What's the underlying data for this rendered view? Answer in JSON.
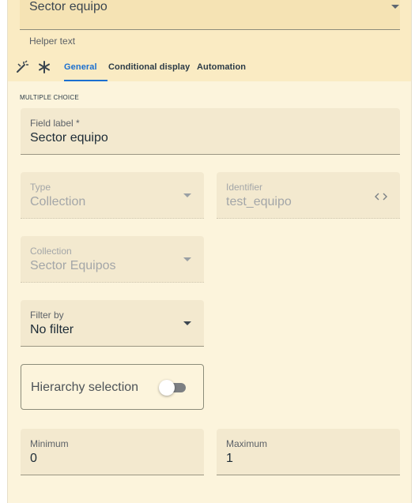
{
  "top_field": {
    "value": "Sector equipo",
    "helper": "Helper text"
  },
  "toolbar": {
    "tabs": [
      {
        "label": "General",
        "active": true
      },
      {
        "label": "Conditional display",
        "active": false
      },
      {
        "label": "Automation",
        "active": false
      }
    ]
  },
  "section": {
    "title": "MULTIPLE CHOICE"
  },
  "fields": {
    "field_label": {
      "label": "Field label *",
      "value": "Sector equipo"
    },
    "type": {
      "label": "Type",
      "value": "Collection",
      "disabled": true
    },
    "identifier": {
      "label": "Identifier",
      "value": "test_equipo",
      "disabled": true
    },
    "collection": {
      "label": "Collection",
      "value": "Sector Equipos",
      "disabled": true
    },
    "filter_by": {
      "label": "Filter by",
      "value": "No filter"
    },
    "hierarchy": {
      "label": "Hierarchy selection",
      "enabled": false
    },
    "minimum": {
      "label": "Minimum",
      "value": "0"
    },
    "maximum": {
      "label": "Maximum",
      "value": "1"
    }
  },
  "icons": [
    "magic-wand-icon",
    "asterisk-icon",
    "chevron-down-icon",
    "code-icon"
  ],
  "colors": {
    "accent": "#1b6fd0",
    "panel_bg": "#fcf4dc",
    "header_bg": "#faebc3"
  }
}
